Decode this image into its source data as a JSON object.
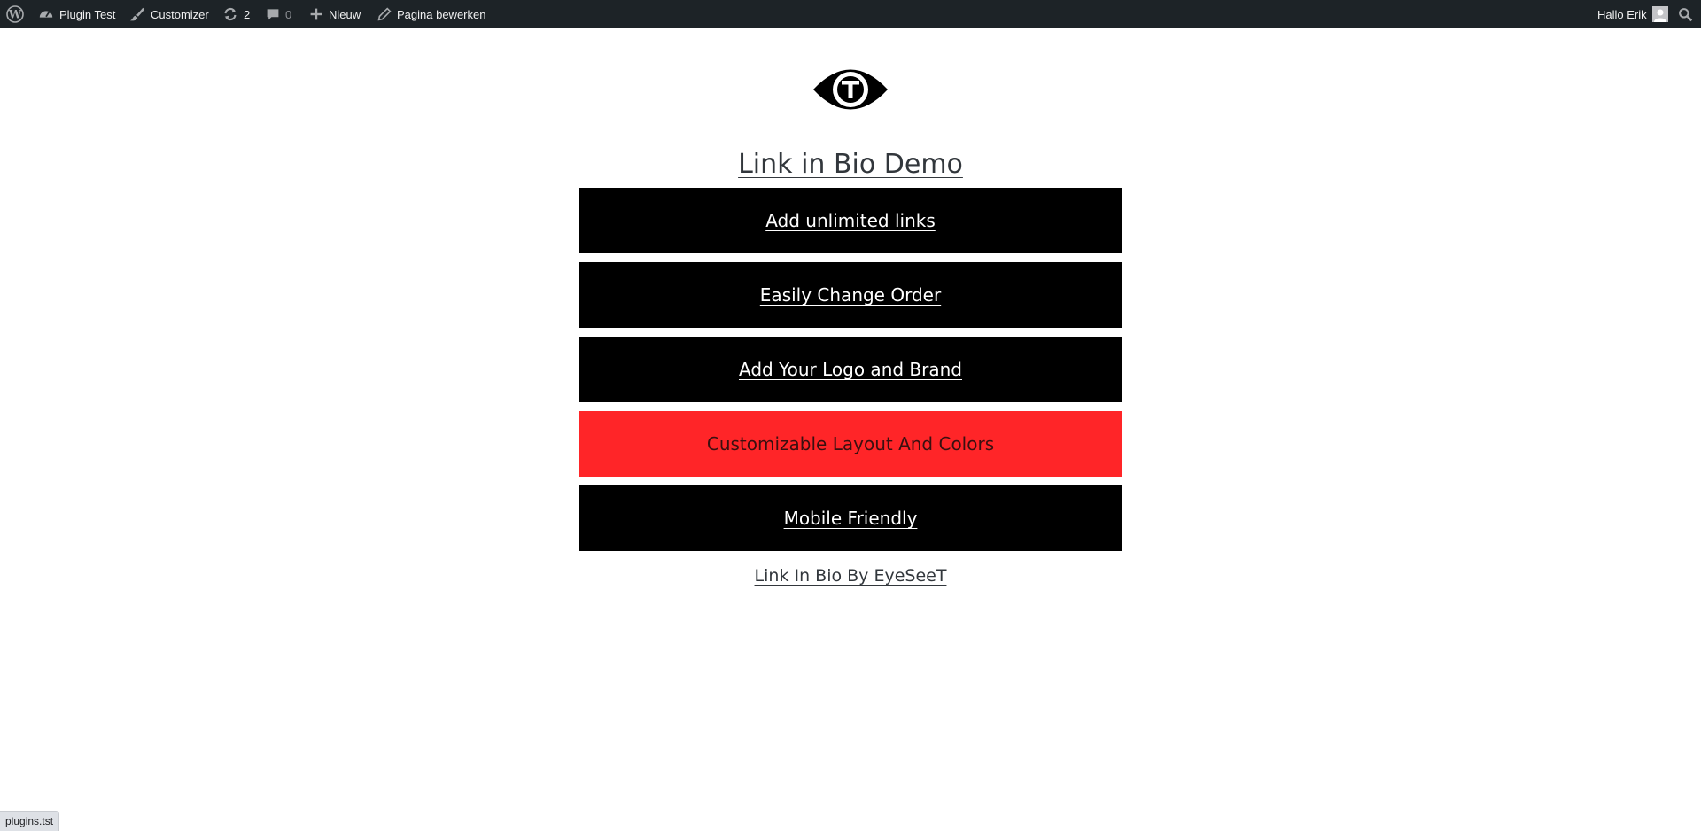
{
  "admin_bar": {
    "wp_logo_icon": "wordpress-icon",
    "site_name": "Plugin Test",
    "customizer": "Customizer",
    "updates_count": "2",
    "comments_count": "0",
    "new_label": "Nieuw",
    "edit_page": "Pagina bewerken",
    "greeting": "Hallo Erik",
    "search_icon": "search-icon",
    "colors": {
      "background": "#1d2327",
      "text": "#f0f0f1"
    }
  },
  "logo_icon": "eye-t-logo",
  "page_title": "Link in Bio Demo",
  "links": [
    {
      "label": "Add unlimited links",
      "style": "default"
    },
    {
      "label": "Easily Change Order",
      "style": "default"
    },
    {
      "label": "Add Your Logo and Brand",
      "style": "default"
    },
    {
      "label": "Customizable Layout And Colors",
      "style": "accent"
    },
    {
      "label": "Mobile Friendly",
      "style": "default"
    }
  ],
  "colors": {
    "button": "#000000",
    "accent_button": "#ff2528",
    "button_text": "#ffffff"
  },
  "footer_credit": "Link In Bio By EyeSeeT",
  "status_bar_url": "plugins.tst"
}
